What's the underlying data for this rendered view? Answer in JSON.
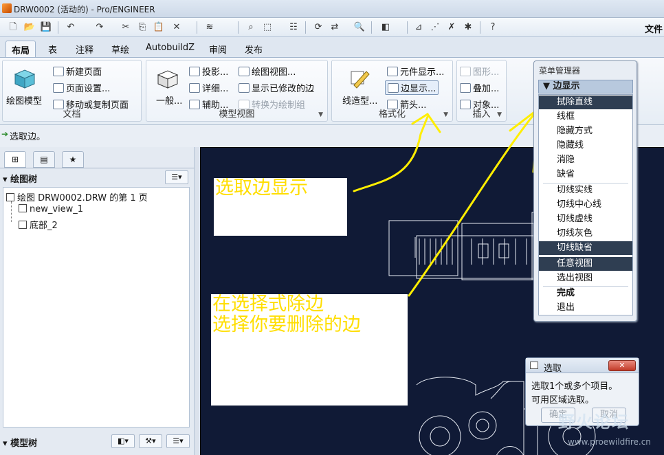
{
  "window": {
    "title": "DRW0002 (活动的) - Pro/ENGINEER"
  },
  "quick_toolbar": {
    "file_menu": "文件"
  },
  "tabs": [
    {
      "label": "布局",
      "active": true
    },
    {
      "label": "表"
    },
    {
      "label": "注释"
    },
    {
      "label": "草绘"
    },
    {
      "label": "AutobuildZ"
    },
    {
      "label": "审阅"
    },
    {
      "label": "发布"
    }
  ],
  "ribbon": {
    "doc_group": {
      "label": "文档",
      "big_button": "绘图模型",
      "new_page": "新建页面",
      "page_setup": "页面设置...",
      "move_copy": "移动或复制页面"
    },
    "model_view_group": {
      "label": "模型视图",
      "general": "一般...",
      "projection": "投影...",
      "detail": "详细...",
      "auxiliary": "辅助...",
      "drawing_view": "绘图视图...",
      "show_modified_edges": "显示已修改的边",
      "convert": "转换为绘制组"
    },
    "format_group": {
      "label": "格式化",
      "line_style": "线造型...",
      "component_display": "元件显示...",
      "edge_display": "边显示...",
      "arrow": "箭头..."
    },
    "insert_group": {
      "label": "插入",
      "graphics": "图形...",
      "overlay": "叠加...",
      "object": "对象..."
    }
  },
  "status": {
    "message": "选取边。"
  },
  "left_panel": {
    "drawing_tree_header": "绘图树",
    "tree_items": [
      "绘图 DRW0002.DRW 的第 1 页",
      "new_view_1",
      "底部_2"
    ],
    "model_tree_header": "模型树"
  },
  "annotations": {
    "note1": "选取边显示",
    "note2_line1": "在选择式除边",
    "note2_line2": "选择你要删除的边"
  },
  "menu_manager": {
    "title": "菜单管理器",
    "header": "边显示",
    "items": [
      {
        "label": "拭除直线",
        "highlighted": true
      },
      {
        "label": "线框"
      },
      {
        "label": "隐藏方式"
      },
      {
        "label": "隐藏线"
      },
      {
        "label": "消隐"
      },
      {
        "label": "缺省"
      },
      {
        "label": "切线实线"
      },
      {
        "label": "切线中心线"
      },
      {
        "label": "切线虚线"
      },
      {
        "label": "切线灰色"
      },
      {
        "label": "切线缺省",
        "highlighted": true
      },
      {
        "label": "任意视图",
        "highlighted": true
      },
      {
        "label": "选出视图"
      },
      {
        "label": "完成"
      },
      {
        "label": "退出"
      }
    ]
  },
  "select_dialog": {
    "title": "选取",
    "line1": "选取1个或多个项目。",
    "line2": "可用区域选取。",
    "ok": "确定",
    "cancel": "取消"
  },
  "watermark": {
    "text": "野火论坛",
    "url": "www.proewildfire.cn"
  },
  "colors": {
    "canvas_bg": "#101a36",
    "annotation_text": "#ffde00",
    "arrow": "#ffee00",
    "highlight": "#2f3e52"
  }
}
